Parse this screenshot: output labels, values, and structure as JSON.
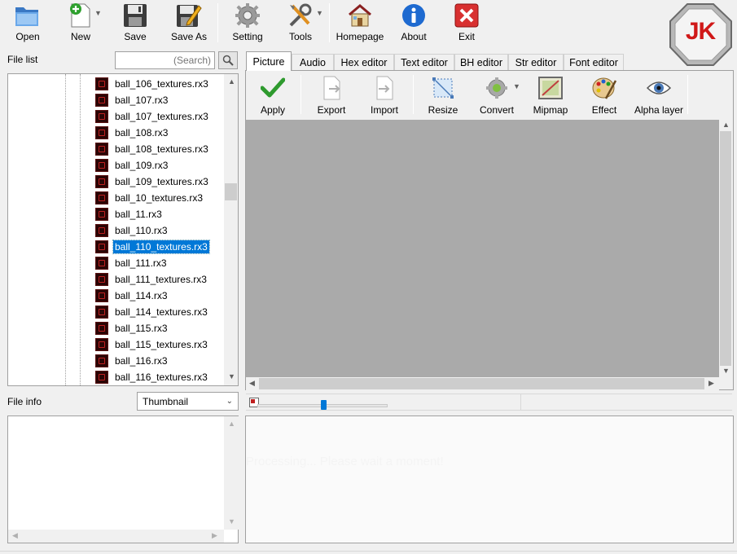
{
  "toolbar": {
    "open": "Open",
    "new": "New",
    "save": "Save",
    "save_as": "Save As",
    "setting": "Setting",
    "tools": "Tools",
    "homepage": "Homepage",
    "about": "About",
    "exit": "Exit"
  },
  "logo": {
    "text": "JK"
  },
  "file_list": {
    "label": "File list",
    "search_placeholder": "(Search)",
    "items": [
      "ball_106_textures.rx3",
      "ball_107.rx3",
      "ball_107_textures.rx3",
      "ball_108.rx3",
      "ball_108_textures.rx3",
      "ball_109.rx3",
      "ball_109_textures.rx3",
      "ball_10_textures.rx3",
      "ball_11.rx3",
      "ball_110.rx3",
      "ball_110_textures.rx3",
      "ball_111.rx3",
      "ball_111_textures.rx3",
      "ball_114.rx3",
      "ball_114_textures.rx3",
      "ball_115.rx3",
      "ball_115_textures.rx3",
      "ball_116.rx3",
      "ball_116_textures.rx3"
    ],
    "selected": "ball_110_textures.rx3"
  },
  "file_info": {
    "label": "File info",
    "view_mode": "Thumbnail"
  },
  "tabs": [
    "Picture",
    "Audio",
    "Hex editor",
    "Text editor",
    "BH editor",
    "Str editor",
    "Font editor"
  ],
  "active_tab": "Picture",
  "picture_toolbar": {
    "apply": "Apply",
    "export": "Export",
    "import": "Import",
    "resize": "Resize",
    "convert": "Convert",
    "mipmap": "Mipmap",
    "effect": "Effect",
    "alpha_layer": "Alpha layer"
  },
  "status": {
    "processing": "Processing... Please wait a moment!"
  },
  "colors": {
    "selection": "#0078d7",
    "canvas": "#aaaaaa",
    "logo_red": "#d01818"
  }
}
